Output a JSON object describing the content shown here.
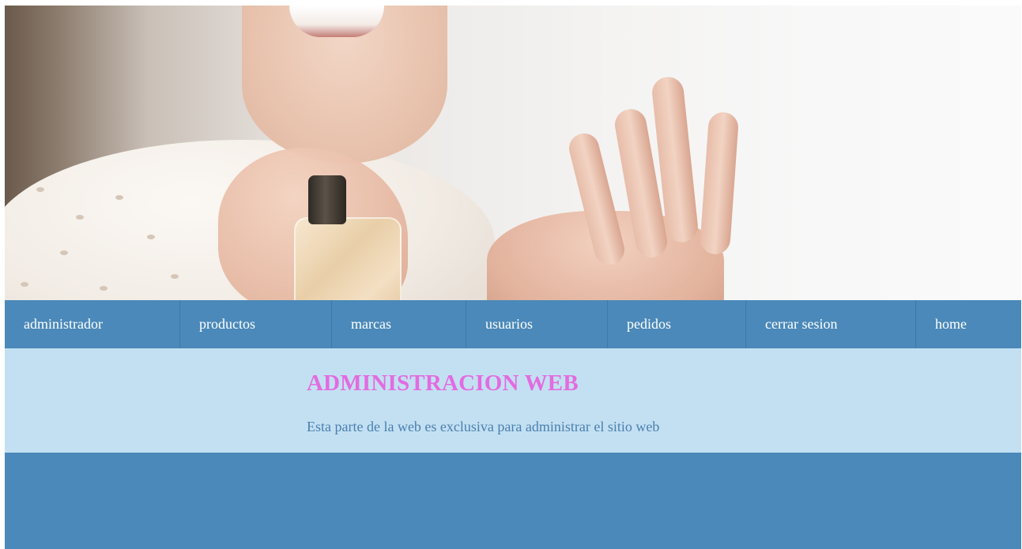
{
  "hero": {
    "image": "perfume-spray-photo"
  },
  "nav": {
    "items": [
      {
        "label": "administrador"
      },
      {
        "label": "productos"
      },
      {
        "label": "marcas"
      },
      {
        "label": "usuarios"
      },
      {
        "label": "pedidos"
      },
      {
        "label": "cerrar sesion"
      },
      {
        "label": "home"
      }
    ]
  },
  "content": {
    "title": "ADMINISTRACION WEB",
    "description": "Esta parte de la web es exclusiva para administrar el sitio web"
  },
  "colors": {
    "nav_background": "#4a89b9",
    "content_background": "#c3e0f2",
    "title_color": "#e36be0",
    "description_color": "#4a7fb0"
  }
}
